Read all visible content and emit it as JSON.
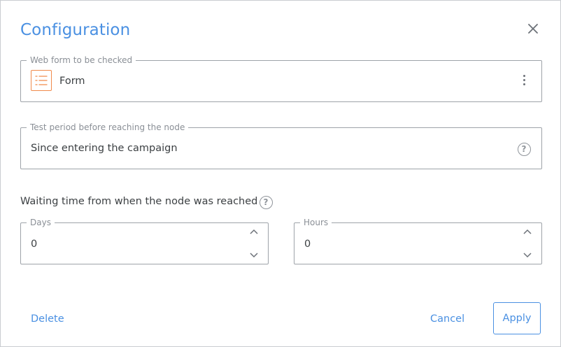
{
  "dialog": {
    "title": "Configuration",
    "close_icon": "close-icon"
  },
  "web_form": {
    "legend": "Web form to be checked",
    "value": "Form",
    "icon": "form-icon",
    "menu_icon": "kebab-icon"
  },
  "test_period": {
    "legend": "Test period before reaching the node",
    "value": "Since entering the campaign",
    "help_icon": "question-icon",
    "help_glyph": "?"
  },
  "waiting": {
    "label": "Waiting time from when the node was reached",
    "help_icon": "question-icon",
    "help_glyph": "?",
    "days": {
      "legend": "Days",
      "value": "0"
    },
    "hours": {
      "legend": "Hours",
      "value": "0"
    }
  },
  "actions": {
    "delete": "Delete",
    "cancel": "Cancel",
    "apply": "Apply"
  },
  "colors": {
    "accent": "#4a90e2",
    "form_icon": "#f08a4b",
    "border": "#9ea3a9"
  }
}
